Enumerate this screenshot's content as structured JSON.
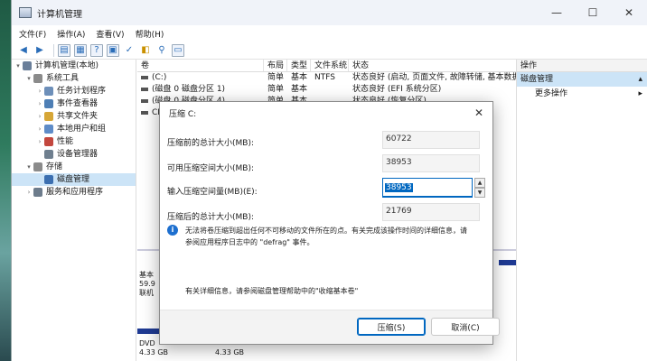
{
  "window": {
    "title": "计算机管理"
  },
  "menu": [
    "文件(F)",
    "操作(A)",
    "查看(V)",
    "帮助(H)"
  ],
  "tree": [
    {
      "label": "计算机管理(本地)",
      "level": 0,
      "twisty": "▾",
      "color": "#6a7f9a"
    },
    {
      "label": "系统工具",
      "level": 1,
      "twisty": "▾",
      "color": "#8b8b8b"
    },
    {
      "label": "任务计划程序",
      "level": 2,
      "twisty": "›",
      "color": "#6d8fb9"
    },
    {
      "label": "事件查看器",
      "level": 2,
      "twisty": "›",
      "color": "#4e7fb5"
    },
    {
      "label": "共享文件夹",
      "level": 2,
      "twisty": "›",
      "color": "#d6a637"
    },
    {
      "label": "本地用户和组",
      "level": 2,
      "twisty": "›",
      "color": "#5e8cc8"
    },
    {
      "label": "性能",
      "level": 2,
      "twisty": "›",
      "color": "#c3473e"
    },
    {
      "label": "设备管理器",
      "level": 2,
      "twisty": "",
      "color": "#6f7f8f"
    },
    {
      "label": "存储",
      "level": 1,
      "twisty": "▾",
      "color": "#8b8b8b"
    },
    {
      "label": "磁盘管理",
      "level": 2,
      "twisty": "",
      "color": "#3c6fb0",
      "selected": true
    },
    {
      "label": "服务和应用程序",
      "level": 1,
      "twisty": "›",
      "color": "#6d7c8c"
    }
  ],
  "list": {
    "headers": [
      "卷",
      "布局",
      "类型",
      "文件系统",
      "状态"
    ],
    "rows": [
      [
        "(C:)",
        "简单",
        "基本",
        "NTFS",
        "状态良好 (启动, 页面文件, 故障转储, 基本数据分区)"
      ],
      [
        "(磁盘 0 磁盘分区 1)",
        "简单",
        "基本",
        "",
        "状态良好 (EFI 系统分区)"
      ],
      [
        "(磁盘 0 磁盘分区 4)",
        "简单",
        "基本",
        "",
        "状态良好 (恢复分区)"
      ],
      [
        "CP",
        "",
        "",
        "",
        ""
      ]
    ]
  },
  "disks": {
    "d0_line1": "基本",
    "d0_line2": "59.9",
    "d0_line3": "联机",
    "d1_line1": "DVD",
    "d1_line2": "4.33 GB",
    "d1_line3": "4.33 GB"
  },
  "actions": {
    "header": "操作",
    "selected": "磁盘管理",
    "more": "更多操作"
  },
  "dialog": {
    "title": "压缩 C:",
    "total_label": "压缩前的总计大小(MB):",
    "total_value": "60722",
    "available_label": "可用压缩空间大小(MB):",
    "available_value": "38953",
    "input_label": "输入压缩空间量(MB)(E):",
    "input_value": "38953",
    "after_label": "压缩后的总计大小(MB):",
    "after_value": "21769",
    "info_line1": "无法将卷压缩到超出任何不可移动的文件所在的点。有关完成该操作时间的详细信息，请",
    "info_line2": "参阅应用程序日志中的 \"defrag\" 事件。",
    "help": "有关详细信息，请参阅磁盘管理帮助中的\"收缩基本卷\"",
    "ok_label": "压缩(S)",
    "cancel_label": "取消(C)"
  }
}
